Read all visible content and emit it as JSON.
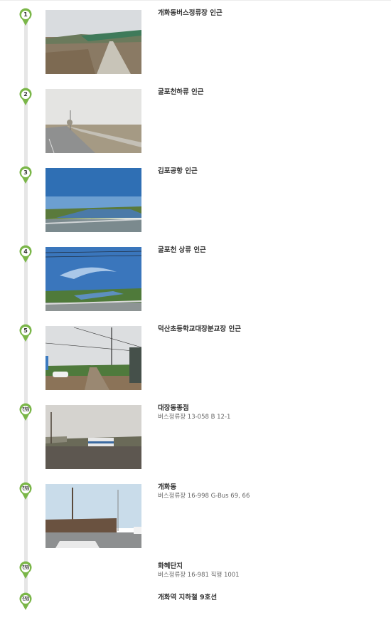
{
  "stops": [
    {
      "badge": "1",
      "title": "개화동버스정류장 인근",
      "subtitle": ""
    },
    {
      "badge": "2",
      "title": "굴포천하류 인근",
      "subtitle": ""
    },
    {
      "badge": "3",
      "title": "김포공항 인근",
      "subtitle": ""
    },
    {
      "badge": "4",
      "title": "굴포천 상류 인근",
      "subtitle": ""
    },
    {
      "badge": "5",
      "title": "덕산초등학교대장분교장 인근",
      "subtitle": ""
    },
    {
      "badge": "진입",
      "title": "대장동종점",
      "subtitle": "버스정류장 13-058 B 12-1"
    },
    {
      "badge": "진입",
      "title": "개화동",
      "subtitle": "버스정류장 16-998 G-Bus 69, 66"
    },
    {
      "badge": "진입",
      "title": "화혜단지",
      "subtitle": "버스정류장 16-981 직행 1001"
    },
    {
      "badge": "진입",
      "title": "개화역 지하철 9호선",
      "subtitle": ""
    }
  ],
  "colors": {
    "marker_ring": "#7ab648",
    "timeline": "#e6e6e6",
    "title_text": "#333333",
    "subtitle_text": "#666666"
  }
}
